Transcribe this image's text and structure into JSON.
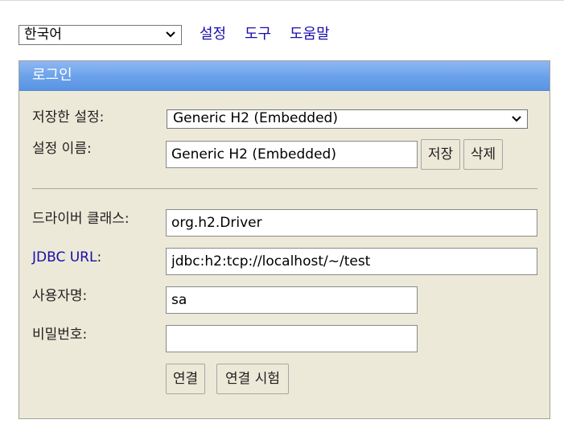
{
  "header": {
    "language": "한국어",
    "links": {
      "preferences": "설정",
      "tools": "도구",
      "help": "도움말"
    }
  },
  "login": {
    "title": "로그인",
    "saved_settings_label": "저장한 설정:",
    "saved_settings_value": "Generic H2 (Embedded)",
    "setting_name_label": "설정 이름:",
    "setting_name_value": "Generic H2 (Embedded)",
    "save_button": "저장",
    "delete_button": "삭제",
    "driver_class_label": "드라이버 클래스:",
    "driver_class_value": "org.h2.Driver",
    "jdbc_url_label_link": "JDBC URL",
    "jdbc_url_label_colon": ":",
    "jdbc_url_value": "jdbc:h2:tcp://localhost/~/test",
    "username_label": "사용자명:",
    "username_value": "sa",
    "password_label": "비밀번호:",
    "password_value": "",
    "connect_button": "연결",
    "test_connection_button": "연결 시험"
  },
  "colors": {
    "header_gradient_top": "#8db8f2",
    "header_gradient_bottom": "#5a93e3",
    "panel_bg": "#ece9d8",
    "link": "#1a0dab"
  }
}
